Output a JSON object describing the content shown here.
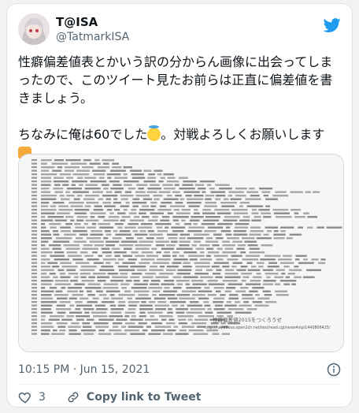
{
  "tweet": {
    "display_name": "T@ISA",
    "handle": "@TatmarkISA",
    "text_line_1": "性癖偏差値表とかいう訳の分からん画像に出会ってしま",
    "text_line_2": "ったので、このツイート見たお前らは正直に偏差値を書",
    "text_line_3": "きましょう。",
    "text_line_4": "ちなみに俺は60でした",
    "text_line_4_suffix": "。対戦よろしくお願いします",
    "timestamp": "10:15 PM · Jun 15, 2021",
    "like_count": "3",
    "copy_link_label": "Copy link to Tweet"
  },
  "media": {
    "credit_line_1": "性癖偏差値2015をつくろうぜ",
    "credit_line_2": "http://hayabusa.open2ch.net/test/read.cgi/news4vip/1440806425/"
  },
  "colors": {
    "brand_blue": "#1d9bf0",
    "like_red": "#f91880",
    "text_primary": "#0f1419",
    "text_secondary": "#536471"
  },
  "icons": {
    "platform": "bird-logo-icon",
    "info": "info-icon",
    "like": "heart-icon",
    "copy_link": "link-icon"
  }
}
